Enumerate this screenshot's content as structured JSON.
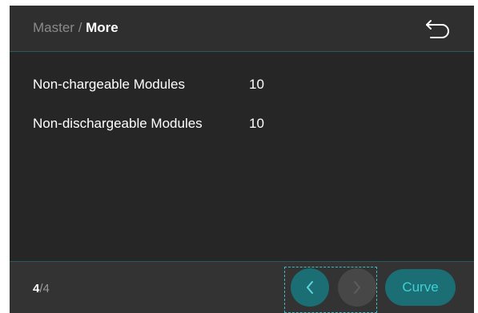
{
  "header": {
    "breadcrumb_parent": "Master",
    "breadcrumb_separator": " / ",
    "breadcrumb_current": "More",
    "back_icon": "undo-back-arrow-icon"
  },
  "rows": [
    {
      "label": "Non-chargeable Modules",
      "value": "10"
    },
    {
      "label": "Non-dischargeable Modules",
      "value": "10"
    }
  ],
  "footer": {
    "page_current": "4",
    "page_separator": "/",
    "page_total": "4",
    "prev_icon": "chevron-left-icon",
    "next_icon": "chevron-right-icon",
    "curve_label": "Curve"
  },
  "colors": {
    "accent": "#1b6e73",
    "accent_text": "#3fd0d6",
    "background": "#2a2a2a"
  }
}
